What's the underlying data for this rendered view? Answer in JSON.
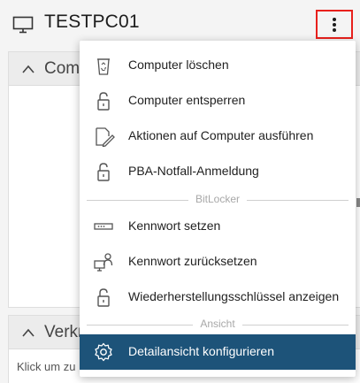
{
  "header": {
    "title": "TESTPC01",
    "icon": "monitor-icon",
    "menu_button_icon": "kebab-menu-icon"
  },
  "panels": [
    {
      "title": "Comp"
    },
    {
      "title": "Verkn",
      "hint": "Klick um zu"
    }
  ],
  "menu": {
    "items_top": [
      {
        "label": "Computer löschen",
        "icon": "recycle-bin-icon"
      },
      {
        "label": "Computer entsperren",
        "icon": "unlock-icon"
      },
      {
        "label": "Aktionen auf Computer ausführen",
        "icon": "document-edit-icon"
      },
      {
        "label": "PBA-Notfall-Anmeldung",
        "icon": "unlock-icon"
      }
    ],
    "section_bitlocker": "BitLocker",
    "items_bitlocker": [
      {
        "label": "Kennwort setzen",
        "icon": "password-field-icon"
      },
      {
        "label": "Kennwort zurücksetzen",
        "icon": "user-computer-icon"
      },
      {
        "label": "Wiederherstellungsschlüssel anzeigen",
        "icon": "unlock-icon"
      }
    ],
    "section_view": "Ansicht",
    "items_view": [
      {
        "label": "Detailansicht konfigurieren",
        "icon": "gear-icon"
      }
    ]
  },
  "colors": {
    "highlight": "#1d5379",
    "outline_red": "#e8201c"
  }
}
